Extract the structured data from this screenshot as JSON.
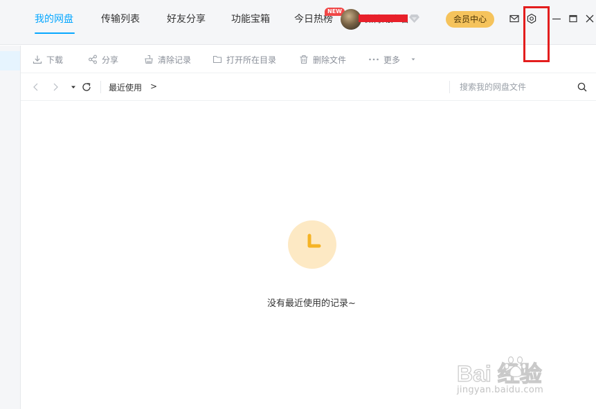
{
  "header": {
    "tabs": [
      {
        "label": "我的网盘",
        "active": true
      },
      {
        "label": "传输列表",
        "active": false
      },
      {
        "label": "好友分享",
        "active": false
      },
      {
        "label": "功能宝箱",
        "active": false
      },
      {
        "label": "今日热榜",
        "active": false
      }
    ],
    "new_badge": "NEW",
    "username": "微博用户名",
    "member_center": "会员中心",
    "accent_color": "#06a7ff",
    "member_color": "#f5c35c",
    "highlight_color": "#e31d1d"
  },
  "toolbar": {
    "download": "下载",
    "share": "分享",
    "clear_history": "清除记录",
    "open_folder": "打开所在目录",
    "delete_file": "删除文件",
    "more": "更多"
  },
  "address_bar": {
    "breadcrumb": "最近使用",
    "breadcrumb_arrow": ">",
    "search_placeholder": "搜索我的网盘文件"
  },
  "empty_state": {
    "icon": "clock-icon",
    "message": "没有最近使用的记录~"
  },
  "watermark": {
    "main": "Bai  经验",
    "sub": "jingyan.baidu.com"
  }
}
